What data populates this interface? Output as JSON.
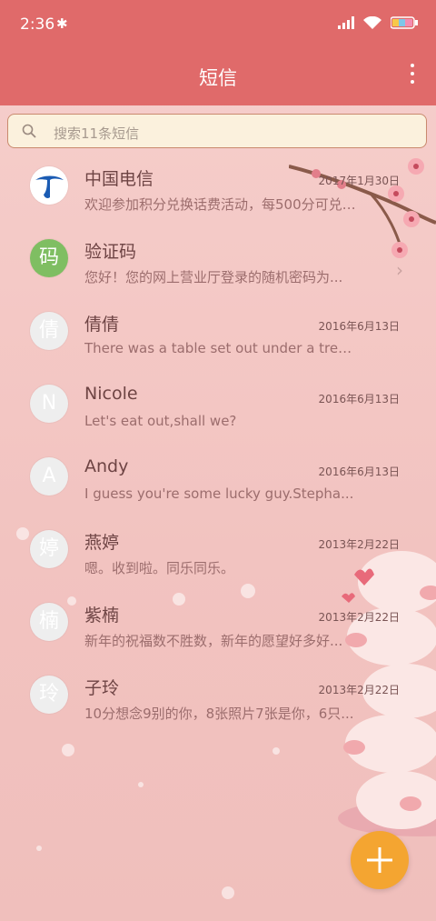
{
  "status_bar": {
    "time": "2:36",
    "bluetooth_icon": "bluetooth-icon",
    "signal_icon": "signal-icon",
    "wifi_icon": "wifi-icon",
    "battery_icon": "battery-icon"
  },
  "app_bar": {
    "title": "短信",
    "menu_icon": "more-vert-icon"
  },
  "search": {
    "placeholder": "搜索11条短信",
    "icon": "search-icon"
  },
  "threads": [
    {
      "avatar_text": "",
      "avatar_kind": "telecom-logo",
      "name": "中国电信",
      "preview": "欢迎参加积分兑换话费活动，每500分可兑换...",
      "date": "2017年1月30日"
    },
    {
      "avatar_text": "码",
      "avatar_kind": "green",
      "name": "验证码",
      "preview": "您好！您的网上营业厅登录的随机密码为...",
      "date": ""
    },
    {
      "avatar_text": "倩",
      "avatar_kind": "gray",
      "name": "倩倩",
      "preview": "There was a table set out under a tree i...",
      "date": "2016年6月13日"
    },
    {
      "avatar_text": "N",
      "avatar_kind": "gray",
      "name": "Nicole",
      "preview": "Let's eat out,shall we?",
      "date": "2016年6月13日"
    },
    {
      "avatar_text": "A",
      "avatar_kind": "gray",
      "name": "Andy",
      "preview": "I guess you're some lucky guy.Stepha...",
      "date": "2016年6月13日"
    },
    {
      "avatar_text": "婷",
      "avatar_kind": "gray",
      "name": "燕婷",
      "preview": "嗯。收到啦。同乐同乐。",
      "date": "2013年2月22日"
    },
    {
      "avatar_text": "楠",
      "avatar_kind": "gray",
      "name": "紫楠",
      "preview": "新年的祝福数不胜数，新年的愿望好多好...",
      "date": "2013年2月22日"
    },
    {
      "avatar_text": "玲",
      "avatar_kind": "gray",
      "name": "子玲",
      "preview": "10分想念9别的你，8张照片7张是你，6只...",
      "date": "2013年2月22日"
    }
  ],
  "fab": {
    "icon": "plus-icon"
  },
  "colors": {
    "header": "#e06a6a",
    "fab": "#f4a531",
    "search_bg": "#fbf1dd",
    "avatar_green": "#7fbe62"
  }
}
